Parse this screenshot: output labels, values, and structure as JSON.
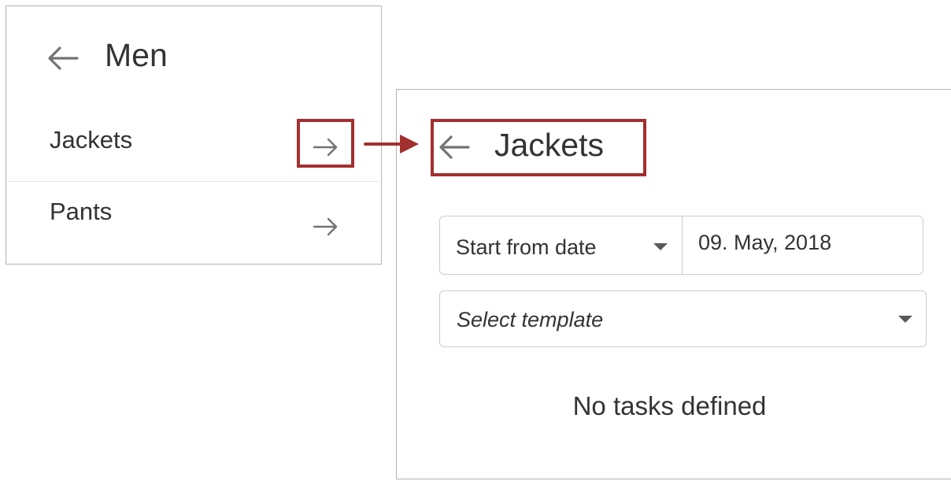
{
  "left_panel": {
    "title": "Men",
    "back_icon": "arrow-left-icon",
    "items": [
      {
        "label": "Jackets",
        "icon": "arrow-right-icon"
      },
      {
        "label": "Pants",
        "icon": "arrow-right-icon"
      }
    ]
  },
  "right_panel": {
    "title": "Jackets",
    "back_icon": "arrow-left-icon",
    "date_mode": {
      "selected": "Start from date",
      "icon": "caret-down-icon"
    },
    "date_value": "09. May, 2018",
    "template": {
      "placeholder": "Select template",
      "icon": "caret-down-icon"
    },
    "empty_message": "No tasks defined"
  },
  "annotation": {
    "highlight_color": "#a32f2f",
    "connector_icon": "arrow-right-icon"
  },
  "colors": {
    "text": "#333333",
    "border": "#b3b3b3",
    "input_border": "#cccccc",
    "icon": "#737373"
  }
}
